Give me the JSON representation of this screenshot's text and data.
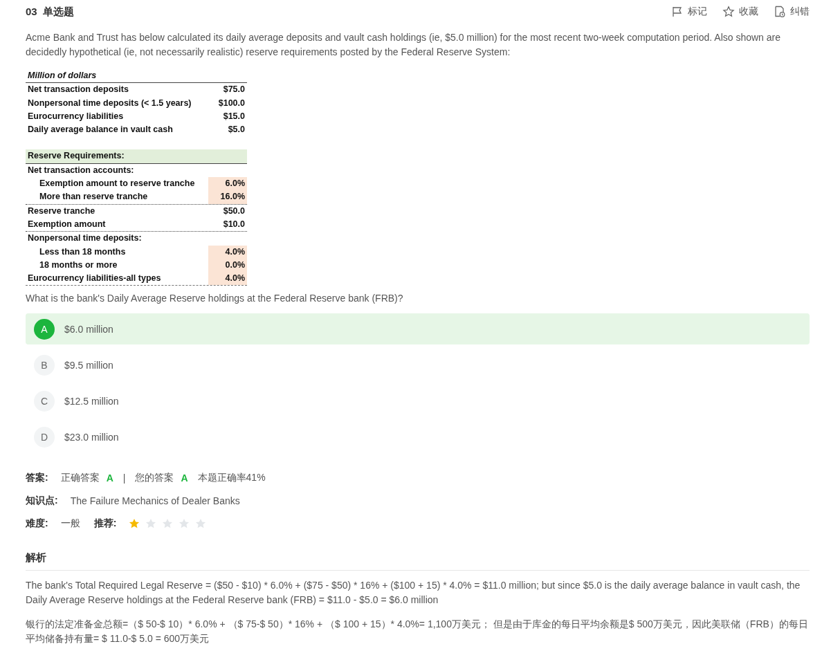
{
  "header": {
    "number": "03",
    "type": "单选题",
    "actions": [
      {
        "kind": "flag",
        "label": "标记"
      },
      {
        "kind": "star",
        "label": "收藏"
      },
      {
        "kind": "report",
        "label": "纠错"
      }
    ]
  },
  "question": "Acme Bank and Trust has below calculated its daily average deposits and vault cash holdings (ie, $5.0 million) for the most recent two-week computation period. Also shown are decidedly hypothetical (ie, not necessarily realistic) reserve requirements posted by the Federal Reserve System:",
  "sheet": [
    {
      "kind": "title",
      "label": "Million of dollars"
    },
    {
      "kind": "solid-rule"
    },
    {
      "kind": "item",
      "label": "Net transaction deposits",
      "value": "$75.0"
    },
    {
      "kind": "item",
      "label": "Nonpersonal time deposits (< 1.5 years)",
      "value": "$100.0"
    },
    {
      "kind": "item",
      "label": "Eurocurrency liabilities",
      "value": "$15.0"
    },
    {
      "kind": "item",
      "label": "Daily average balance in vault cash",
      "value": "$5.0"
    },
    {
      "kind": "blank"
    },
    {
      "kind": "section",
      "label": "Reserve Requirements:"
    },
    {
      "kind": "solid-rule"
    },
    {
      "kind": "item",
      "label": "Net transaction accounts:"
    },
    {
      "kind": "sub",
      "label": "Exemption amount to reserve tranche",
      "value": "6.0%",
      "shaded": true
    },
    {
      "kind": "sub",
      "label": "More than reserve tranche",
      "value": "16.0%",
      "shaded": true
    },
    {
      "kind": "dotted-rule"
    },
    {
      "kind": "item",
      "label": "Reserve tranche",
      "value": "$50.0"
    },
    {
      "kind": "item",
      "label": "Exemption amount",
      "value": "$10.0"
    },
    {
      "kind": "dotted-rule"
    },
    {
      "kind": "item",
      "label": "Nonpersonal time deposits:"
    },
    {
      "kind": "sub",
      "label": "Less than 18 months",
      "value": "4.0%",
      "shaded": true
    },
    {
      "kind": "sub",
      "label": "18 months or more",
      "value": "0.0%",
      "shaded": true
    },
    {
      "kind": "item",
      "label": "Eurocurrency liabilities-all types",
      "value": "4.0%",
      "shaded": true
    },
    {
      "kind": "dashed-rule"
    }
  ],
  "prompt": "What is the bank's Daily Average Reserve holdings at the Federal Reserve bank (FRB)?",
  "options": [
    {
      "letter": "A",
      "text": "$6.0 million",
      "selected": true
    },
    {
      "letter": "B",
      "text": "$9.5 million",
      "selected": false
    },
    {
      "letter": "C",
      "text": "$12.5 million",
      "selected": false
    },
    {
      "letter": "D",
      "text": "$23.0 million",
      "selected": false
    }
  ],
  "answer": {
    "label": "答案:",
    "correct_label": "正确答案",
    "correct": "A",
    "separator": "|",
    "yours_label": "您的答案",
    "yours": "A",
    "rate": "本题正确率41%"
  },
  "topic": {
    "label": "知识点:",
    "value": "The Failure Mechanics of Dealer Banks"
  },
  "difficulty": {
    "label": "难度:",
    "value": "一般",
    "rec_label": "推荐:",
    "stars": 1
  },
  "analysis": {
    "title": "解析",
    "paragraphs": [
      "The bank's Total Required Legal Reserve = ($50 - $10) * 6.0% + ($75 - $50) * 16% + ($100  + 15) * 4.0% = $11.0 million; but since $5.0 is the daily average balance in vault cash, the Daily Average Reserve holdings at the Federal Reserve bank (FRB) = $11.0 - $5.0 = $6.0 million",
      "银行的法定准备金总额=（$ 50-$ 10）* 6.0% + （$ 75-$ 50）* 16% + （$ 100 + 15）* 4.0%= 1,100万美元； 但是由于库金的每日平均余额是$ 500万美元，因此美联储（FRB）的每日平均储备持有量= $ 11.0-$ 5.0 = 600万美元"
    ]
  }
}
